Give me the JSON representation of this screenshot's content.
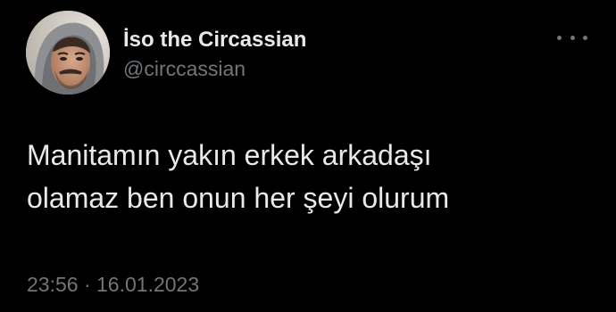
{
  "author": {
    "display_name": "İso the Circassian",
    "handle": "@circcassian",
    "avatar": "profile-photo"
  },
  "tweet": {
    "lines": [
      "Manitamın yakın erkek arkadaşı",
      "olamaz ben onun her şeyi olurum"
    ]
  },
  "meta": {
    "time": "23:56",
    "separator": "·",
    "date": "16.01.2023"
  },
  "icons": {
    "more": "more-horizontal-icon"
  },
  "colors": {
    "background": "#000000",
    "primary_text": "#e7e9ea",
    "secondary_text": "#71767b"
  }
}
